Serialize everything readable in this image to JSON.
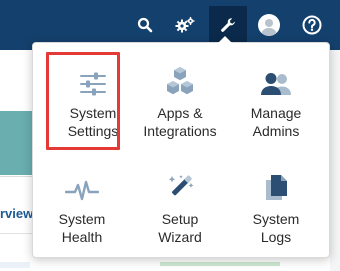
{
  "topbar": {
    "icons": [
      "search-icon",
      "gear-icon",
      "wrench-icon",
      "avatar-icon",
      "help-icon"
    ],
    "active_icon": "wrench-icon",
    "background_color": "#14406d"
  },
  "background": {
    "overview_tab_text": "rview"
  },
  "admin_menu": {
    "items": [
      {
        "label": "System\nSettings",
        "icon": "sliders-icon",
        "highlighted": true
      },
      {
        "label": "Apps &\nIntegrations",
        "icon": "cubes-icon"
      },
      {
        "label": "Manage\nAdmins",
        "icon": "users-icon"
      },
      {
        "label": "System\nHealth",
        "icon": "heartbeat-icon"
      },
      {
        "label": "Setup\nWizard",
        "icon": "magic-wand-icon"
      },
      {
        "label": "System\nLogs",
        "icon": "files-icon"
      }
    ],
    "highlight_color": "#e53935",
    "icon_color": "#8aa3bd"
  }
}
